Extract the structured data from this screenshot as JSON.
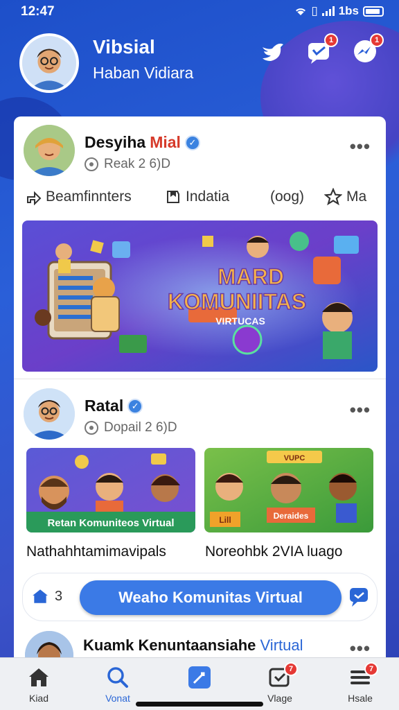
{
  "status_bar": {
    "time": "12:47",
    "network": "1bs"
  },
  "header": {
    "app_name": "Vibsial",
    "user_name": "Haban Vidiara",
    "message_badge": "1",
    "messenger_badge": "1"
  },
  "post1": {
    "name": "Desyiha",
    "name_suffix": "Mial",
    "meta": "Reak 2 6)D",
    "actions": {
      "share": "Beamfinnters",
      "save": "Indatia",
      "count": "(oog)",
      "like": "Ma"
    },
    "banner_line1": "MARD",
    "banner_line2": "KOMUNIITAS",
    "banner_line3": "VIRTUCAS"
  },
  "post2": {
    "name": "Ratal",
    "meta": "Dopail 2 6)D",
    "thumb1_text": "Retan Komuniteos Virtual",
    "thumb2_top": "VUPC",
    "thumb2_left": "Lill",
    "thumb2_right": "Deraides",
    "caption1": "Nathahhtamimavipals",
    "caption2": "Noreohbk 2VIA luago"
  },
  "cta": {
    "count": "3",
    "button": "Weaho Komunitas Virtual"
  },
  "post3": {
    "name": "Kuamk Kenuntaansiahe",
    "name_blue": "Virtual"
  },
  "tabs": [
    {
      "label": "Kiad"
    },
    {
      "label": "Vonat"
    },
    {
      "label": ""
    },
    {
      "label": "Vlage",
      "badge": "7"
    },
    {
      "label": "Hsale",
      "badge": "7"
    }
  ],
  "colors": {
    "primary": "#3b7ae6",
    "header_bg": "#1d4fc9",
    "badge": "#e53935"
  }
}
